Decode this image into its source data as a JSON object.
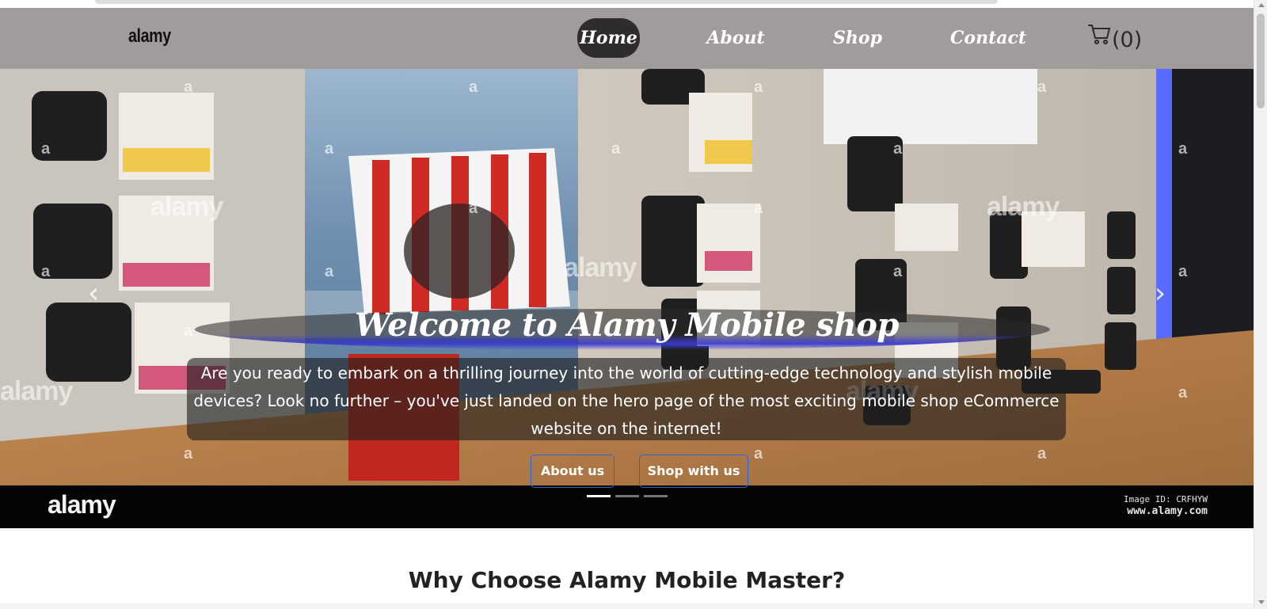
{
  "navbar": {
    "brand": "alamy",
    "links": [
      {
        "label": "Home",
        "active": true
      },
      {
        "label": "About",
        "active": false
      },
      {
        "label": "Shop",
        "active": false
      },
      {
        "label": "Contact",
        "active": false
      }
    ],
    "cart_count": "(0)",
    "cart_icon": "cart-icon",
    "bg_color": "#a19b9b",
    "active_bg_color": "#2e2c2c"
  },
  "hero": {
    "title": "Welcome to Alamy Mobile shop",
    "description": "Are you ready to embark on a thrilling journey into the world of cutting-edge technology and stylish mobile devices? Look no further – you've just landed on the hero page of the most exciting mobile shop eCommerce website on the internet!",
    "buttons": [
      {
        "label": "About us"
      },
      {
        "label": "Shop with us"
      }
    ],
    "prev_icon": "chevron-left-icon",
    "next_icon": "chevron-right-icon",
    "prev_glyph": "‹",
    "next_glyph": "›",
    "slides_count": 3,
    "active_slide": 0,
    "watermark": {
      "logo": "alamy",
      "image_id": "Image ID: CRFHYW",
      "site": "www.alamy.com"
    },
    "button_border_color": "#2f63d8"
  },
  "section": {
    "heading": "Why Choose Alamy Mobile Master?"
  }
}
